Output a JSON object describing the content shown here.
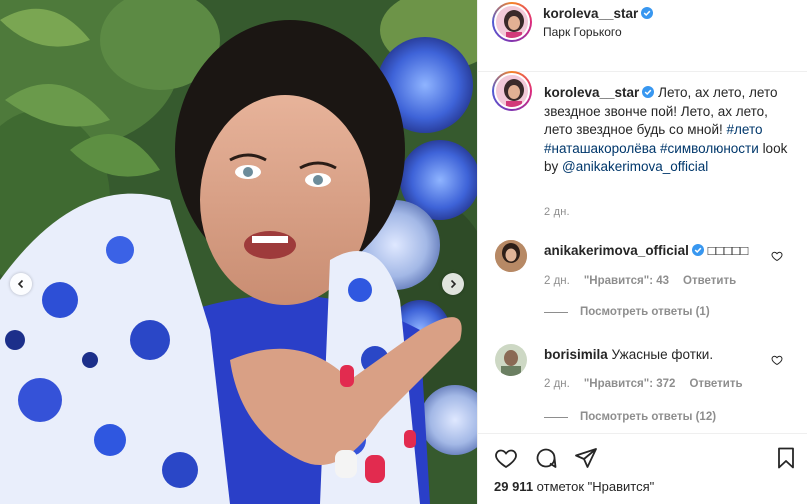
{
  "post": {
    "username": "koroleva__star",
    "location": "Парк Горького",
    "caption_text": "Лето, ах лето, лето звездное звонче пой! Лето, ах лето, лето звездное будь со мной!",
    "caption_tags": [
      "#лето",
      "#наташакоролёва",
      "#символюности"
    ],
    "caption_tail": "look by",
    "caption_mention": "@anikakerimova_official",
    "time_ago": "2 дн.",
    "likes_count": "29 911",
    "likes_suffix": "отметок \"Нравится\""
  },
  "comments": [
    {
      "username": "anikakerimova_official",
      "text": "□□□□□",
      "time": "2 дн.",
      "likes": "\"Нравится\": 43",
      "reply": "Ответить",
      "view_replies": "Посмотреть ответы (1)"
    },
    {
      "username": "borisimila",
      "text": "Ужасные фотки.",
      "time": "2 дн.",
      "likes": "\"Нравится\": 372",
      "reply": "Ответить",
      "view_replies": "Посмотреть ответы (12)"
    }
  ],
  "icons": {
    "verified": "verified-badge-icon",
    "like": "heart-icon",
    "comment": "comment-icon",
    "share": "share-icon",
    "save": "bookmark-icon",
    "prev": "chevron-left-icon",
    "next": "chevron-right-icon"
  },
  "colors": {
    "verified": "#3897f0",
    "tag": "#00376b",
    "meta": "#8e8e8e",
    "text": "#262626"
  }
}
